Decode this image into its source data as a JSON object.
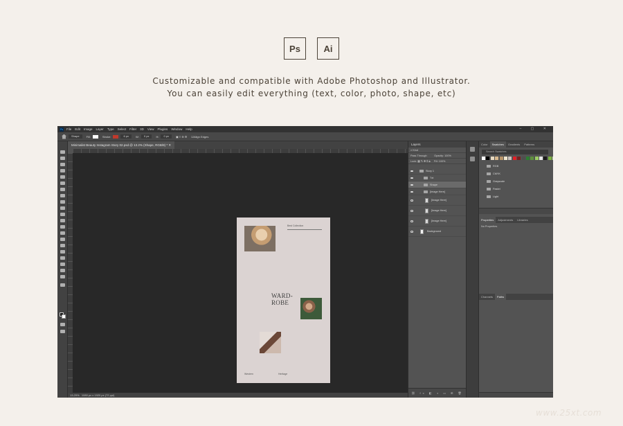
{
  "badges": {
    "ps": "Ps",
    "ai": "Ai"
  },
  "tagline": {
    "line1": "Customizable and compatible with Adobe Photoshop and Illustrator.",
    "line2": "You can easily edit everything (text, color, photo, shape, etc)"
  },
  "photoshop": {
    "app_icon": "Ps",
    "menu": [
      "File",
      "Edit",
      "Image",
      "Layer",
      "Type",
      "Select",
      "Filter",
      "3D",
      "View",
      "Plugins",
      "Window",
      "Help"
    ],
    "options_bar": {
      "tool_mode": "Shape",
      "fill_label": "Fill:",
      "stroke_label": "Stroke:",
      "stroke_width": "6 px",
      "w_label": "W:",
      "w_value": "0 px",
      "h_label": "H:",
      "h_value": "0 px",
      "align_edges": "Align Edges"
    },
    "document_tab": "Minimalist Beauty Instagram Story 02.psd @ 13.2% (Shape, RGB/8) *",
    "status": {
      "zoom": "13.29%",
      "doc_size": "1080 px x 1920 px (72 ppi)"
    },
    "artboard": {
      "heading": "Best Collection",
      "wordmark_line1": "WARD-",
      "wordmark_line2": "ROBE",
      "footer_left": "Western",
      "footer_right": "Heritage"
    },
    "layers_panel": {
      "title": "Layers",
      "filter_label": "Kind",
      "blend_mode": "Pass Through",
      "opacity_label": "Opacity:",
      "opacity_value": "100%",
      "lock_label": "Lock:",
      "fill_label": "Fill:",
      "fill_value": "100%",
      "layers": [
        {
          "name": "Story 1",
          "kind": "group",
          "indent": 0,
          "selected": false
        },
        {
          "name": "Txt",
          "kind": "group",
          "indent": 1,
          "selected": false
        },
        {
          "name": "Shape",
          "kind": "group",
          "indent": 1,
          "selected": true
        },
        {
          "name": "[Image Here]",
          "kind": "group",
          "indent": 1,
          "selected": false
        },
        {
          "name": "[Image Here]",
          "kind": "smart",
          "indent": 2,
          "selected": false
        },
        {
          "name": "[Image Here]",
          "kind": "smart",
          "indent": 2,
          "selected": false
        },
        {
          "name": "[Image Here]",
          "kind": "smart",
          "indent": 2,
          "selected": false
        },
        {
          "name": "Background",
          "kind": "pixel",
          "indent": 0,
          "selected": false
        }
      ]
    },
    "swatches_panel": {
      "tabs": [
        "Color",
        "Swatches",
        "Gradients",
        "Patterns"
      ],
      "active_tab": "Swatches",
      "search_placeholder": "Search Swatches",
      "colors": [
        "#ffffff",
        "#000000",
        "#e7d9c0",
        "#d8b98f",
        "#b8956a",
        "#efe6cf",
        "#c9c2bd",
        "#e21f26",
        "#7a2020",
        "#4f4f4f",
        "#2e7d32",
        "#5e8f3e",
        "#9ccc65",
        "#e6e6e6",
        "#1a1a1a",
        "#7cb342",
        "#c5e1a5"
      ],
      "groups": [
        "RGB",
        "CMYK",
        "Grayscale",
        "Pastel",
        "Light"
      ]
    },
    "properties_panel": {
      "tabs": [
        "Properties",
        "Adjustments",
        "Libraries"
      ],
      "active_tab": "Properties",
      "body": "No Properties"
    },
    "channels_panel": {
      "tabs": [
        "Channels",
        "Paths"
      ],
      "active_tab": "Paths"
    }
  },
  "watermark": "www.25xt.com"
}
